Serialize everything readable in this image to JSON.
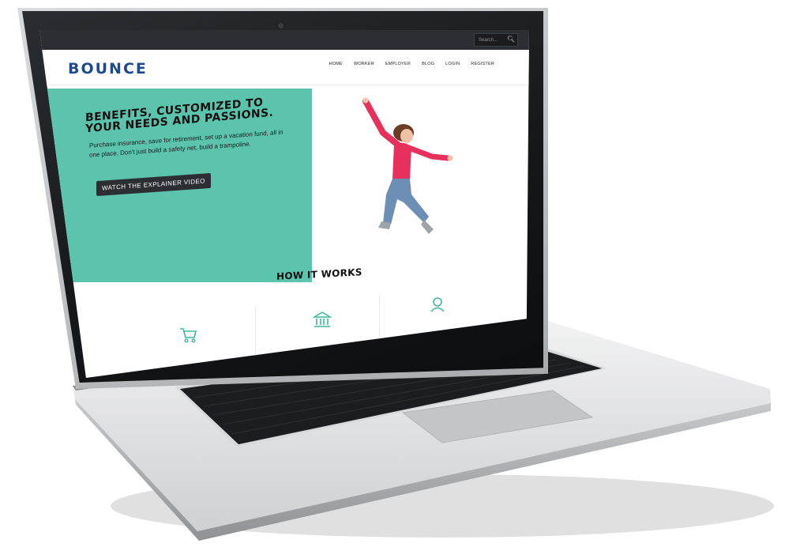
{
  "site": {
    "search_placeholder": "Search...",
    "logo_text": "BOUNCE",
    "nav": [
      "HOME",
      "WORKER",
      "EMPLOYER",
      "BLOG",
      "LOGIN",
      "REGISTER"
    ]
  },
  "hero": {
    "title_line1": "BENEFITS, CUSTOMIZED TO",
    "title_line2": "YOUR NEEDS AND PASSIONS.",
    "text": "Purchase insurance, save for retirement, set up a vacation fund, all in one place. Don't just build a safety net, build a trampoline.",
    "button_label": "WATCH THE EXPLAINER VIDEO"
  },
  "how_it_works": {
    "title": "HOW IT WORKS",
    "icons": [
      "cart-icon",
      "bank-icon",
      "person-icon"
    ]
  },
  "colors": {
    "accent": "#5cc3ad",
    "logo_blue": "#1e4b8e",
    "dark": "#2b2f34"
  }
}
